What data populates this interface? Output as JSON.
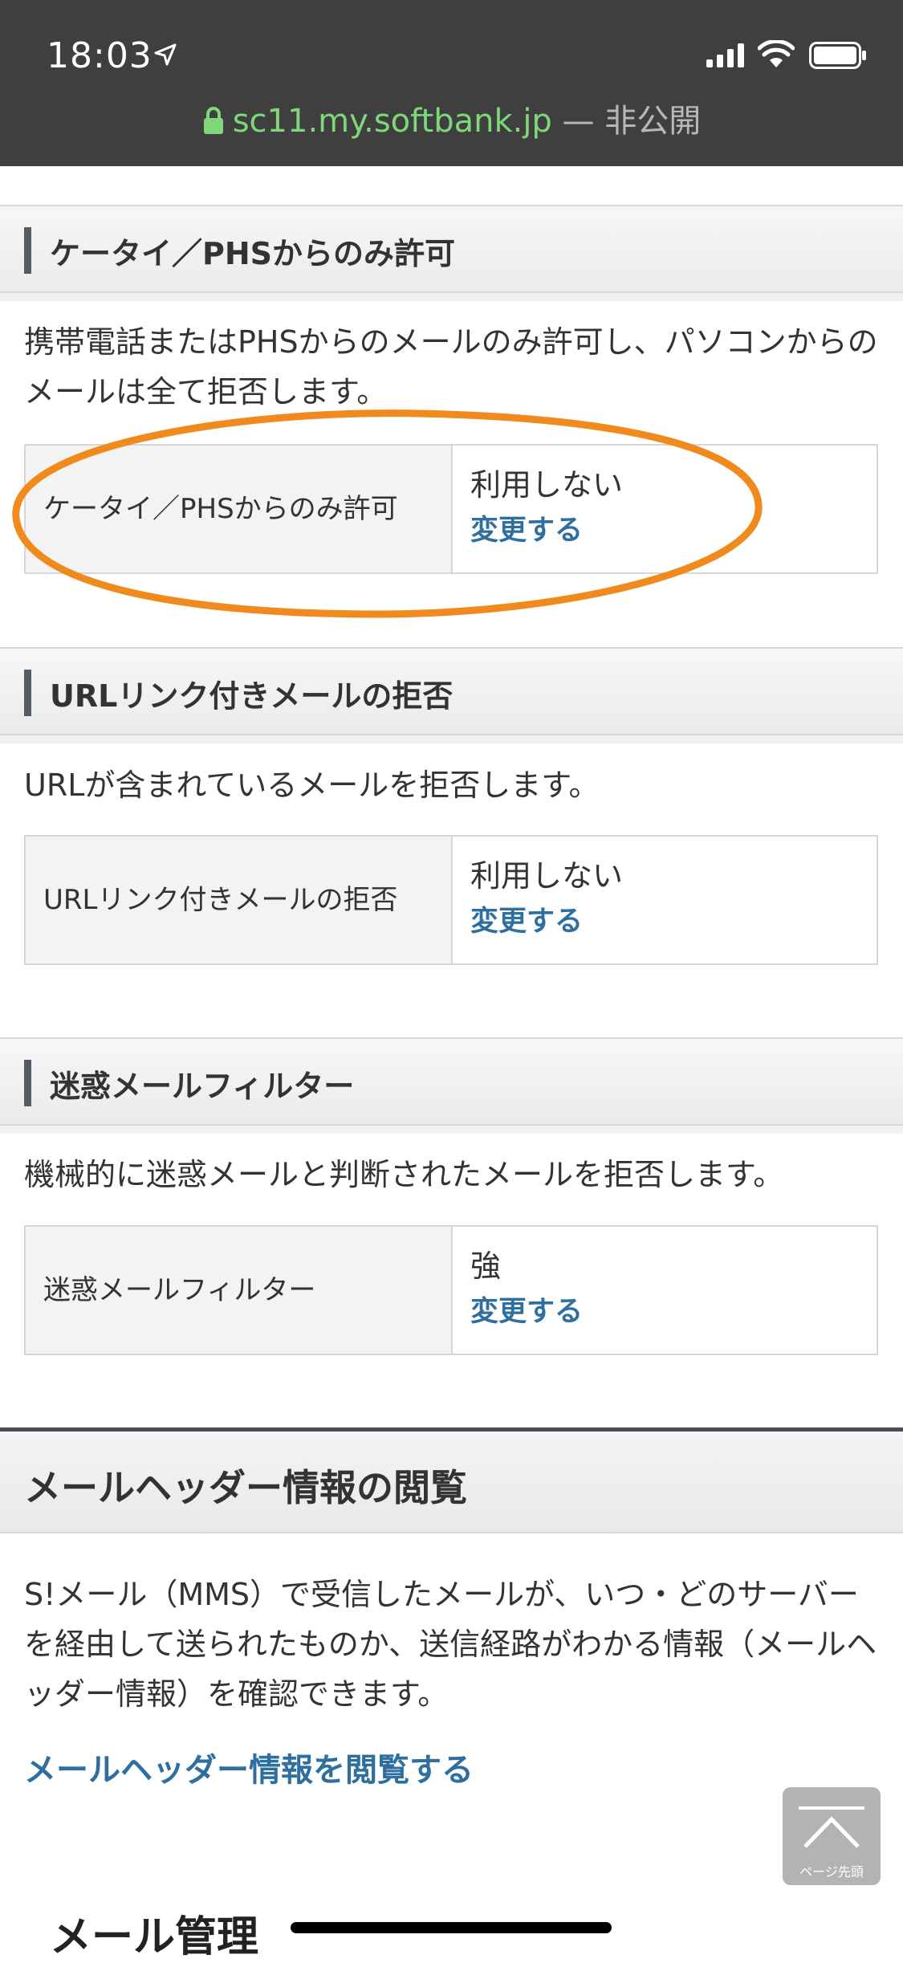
{
  "status_bar": {
    "time": "18:03",
    "icons": [
      "location-arrow-icon",
      "cellular-signal-icon",
      "wifi-icon",
      "battery-icon"
    ]
  },
  "url_bar": {
    "domain": "sc11.my.softbank.jp",
    "separator": " — ",
    "privacy": "非公開",
    "domain_color": "#7ed87a"
  },
  "sections": [
    {
      "title": "ケータイ／PHSからのみ許可",
      "description": "携帯電話またはPHSからのメールのみ許可し、パソコンからのメールは全て拒否します。",
      "setting_label": "ケータイ／PHSからのみ許可",
      "setting_value": "利用しない",
      "change_link": "変更する"
    },
    {
      "title": "URLリンク付きメールの拒否",
      "description": "URLが含まれているメールを拒否します。",
      "setting_label": "URLリンク付きメールの拒否",
      "setting_value": "利用しない",
      "change_link": "変更する"
    },
    {
      "title": "迷惑メールフィルター",
      "description": "機械的に迷惑メールと判断されたメールを拒否します。",
      "setting_label": "迷惑メールフィルター",
      "setting_value": "強",
      "change_link": "変更する"
    }
  ],
  "header_info": {
    "title": "メールヘッダー情報の閲覧",
    "description": "S!メール（MMS）で受信したメールが、いつ・どのサーバーを経由して送られたものか、送信経路がわかる情報（メールヘッダー情報）を確認できます。",
    "link": "メールヘッダー情報を閲覧する"
  },
  "back_to_top": {
    "label": "ページ先頭"
  },
  "footer": {
    "title": "メール管理"
  },
  "colors": {
    "link": "#2e6fa0",
    "annotation_oval": "#f08a1c",
    "top_bar": "#3f3f3f"
  }
}
